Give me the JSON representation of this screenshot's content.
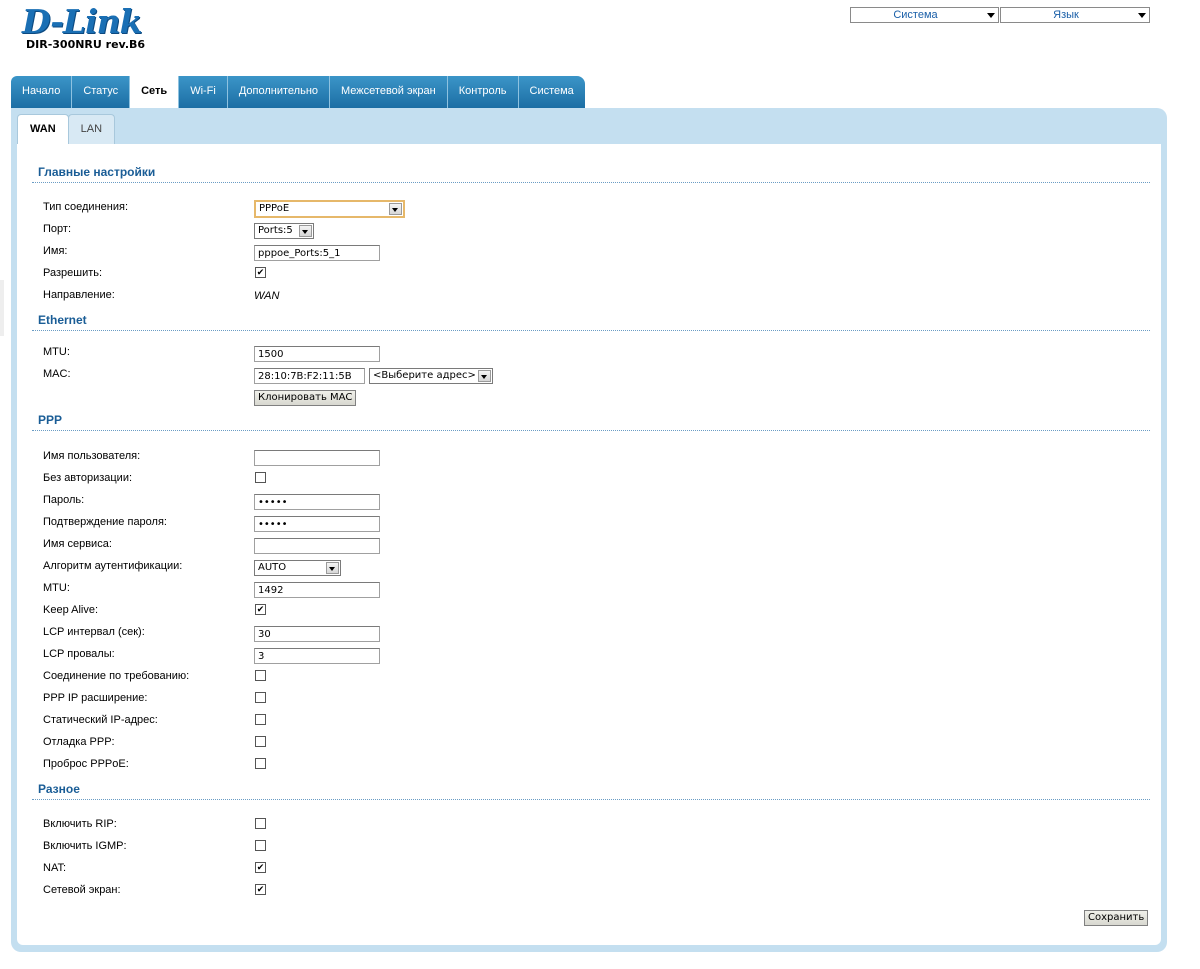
{
  "header": {
    "logo": "D-Link",
    "model": "DIR-300NRU rev.B6",
    "system_select": "Система",
    "language_select": "Язык"
  },
  "main_tabs": [
    {
      "label": "Начало"
    },
    {
      "label": "Статус"
    },
    {
      "label": "Сеть"
    },
    {
      "label": "Wi-Fi"
    },
    {
      "label": "Дополнительно"
    },
    {
      "label": "Межсетевой экран"
    },
    {
      "label": "Контроль"
    },
    {
      "label": "Система"
    }
  ],
  "active_main_tab": "Сеть",
  "sub_tabs": [
    {
      "label": "WAN"
    },
    {
      "label": "LAN"
    }
  ],
  "active_sub_tab": "WAN",
  "main": {
    "title": "Главные настройки",
    "connection_type_label": "Тип соединения:",
    "connection_type_value": "PPPoE",
    "port_label": "Порт:",
    "port_value": "Ports:5",
    "name_label": "Имя:",
    "name_value": "pppoe_Ports:5_1",
    "enable_label": "Разрешить:",
    "enable_checked": true,
    "direction_label": "Направление:",
    "direction_value": "WAN"
  },
  "ethernet": {
    "title": "Ethernet",
    "mtu_label": "MTU:",
    "mtu_value": "1500",
    "mac_label": "MAC:",
    "mac_value": "28:10:7B:F2:11:5B",
    "mac_select": "<Выберите адрес>",
    "clone_button": "Клонировать MAC"
  },
  "ppp": {
    "title": "PPP",
    "username_label": "Имя пользователя:",
    "username_value": "",
    "no_auth_label": "Без авторизации:",
    "password_label": "Пароль:",
    "password_value": "•••••",
    "confirm_label": "Подтверждение пароля:",
    "confirm_value": "•••••",
    "service_label": "Имя сервиса:",
    "service_value": "",
    "auth_label": "Алгоритм аутентификации:",
    "auth_value": "AUTO",
    "mtu_label": "MTU:",
    "mtu_value": "1492",
    "keepalive_label": "Keep Alive:",
    "lcp_interval_label": "LCP интервал (сек):",
    "lcp_interval_value": "30",
    "lcp_fail_label": "LCP провалы:",
    "lcp_fail_value": "3",
    "on_demand_label": "Соединение по требованию:",
    "ip_ext_label": "PPP IP расширение:",
    "static_ip_label": "Статический IP-адрес:",
    "debug_label": "Отладка PPP:",
    "passthrough_label": "Проброс PPPoE:"
  },
  "misc": {
    "title": "Разное",
    "rip_label": "Включить RIP:",
    "igmp_label": "Включить IGMP:",
    "nat_label": "NAT:",
    "firewall_label": "Сетевой экран:"
  },
  "save_button": "Сохранить"
}
